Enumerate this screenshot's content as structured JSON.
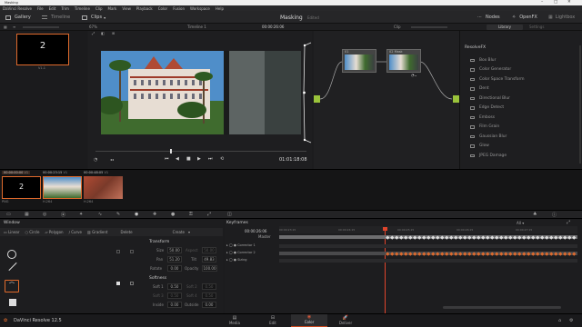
{
  "app": {
    "title": "Masking",
    "window_controls": [
      "–",
      "□",
      "✕"
    ]
  },
  "menu": [
    "DaVinci Resolve",
    "File",
    "Edit",
    "Trim",
    "Timeline",
    "Clip",
    "Mark",
    "View",
    "Playback",
    "Color",
    "Fusion",
    "Workspace",
    "Help"
  ],
  "toolbar": {
    "gallery": "Gallery",
    "timeline": "Timeline",
    "clips": "Clips",
    "project_name": "Masking",
    "project_status": "Edited",
    "nodes": "Nodes",
    "openfx": "OpenFX",
    "lightbox": "Lightbox"
  },
  "subbar": {
    "zoom": "67%",
    "timeline_name": "Timeline 1",
    "timecode": "00:00:26:06",
    "mode": "Clip",
    "library_tab": "Library",
    "settings_tab": "Settings"
  },
  "gallery": {
    "still_number": "2",
    "still_label": "V1.1"
  },
  "viewer": {
    "timecode": "01:01:18:08"
  },
  "nodes": {
    "node1_label": "01",
    "node2_label": "02 Mask",
    "node_tag_1": "",
    "node_tag_2": ""
  },
  "openfx": {
    "header": "ResolveFX",
    "items": [
      "Box Blur",
      "Color Generator",
      "Color Space Transform",
      "Dent",
      "Directional Blur",
      "Edge Detect",
      "Emboss",
      "Film Grain",
      "Gaussian Blur",
      "Glow",
      "JPEG Damage"
    ]
  },
  "clips": [
    {
      "tc": "00:00:00:00",
      "track": "V1",
      "codec": "PNG",
      "thumb_text": "2"
    },
    {
      "tc": "00:00:23:15",
      "track": "V1",
      "codec": "H.264",
      "thumb_text": ""
    },
    {
      "tc": "00:00:48:05",
      "track": "V1",
      "codec": "H.264",
      "thumb_text": ""
    }
  ],
  "window_panel": {
    "title": "Window",
    "shapes": [
      "Linear",
      "Circle",
      "Polygon",
      "Curve",
      "Gradient"
    ],
    "delete": "Delete",
    "create": "Create",
    "transform_title": "Transform",
    "size_label": "Size",
    "size_value": "50.00",
    "aspect_label": "Aspect",
    "aspect_value": "50.00",
    "pan_label": "Pan",
    "pan_value": "51.20",
    "tilt_label": "Tilt",
    "tilt_value": "49.83",
    "rotate_label": "Rotate",
    "rotate_value": "0.00",
    "opacity_label": "Opacity",
    "opacity_value": "100.00",
    "softness_title": "Softness",
    "soft1_label": "Soft 1",
    "soft1_value": "0.50",
    "soft2_label": "Soft 2",
    "soft2_value": "0.50",
    "soft3_label": "Soft 3",
    "soft3_value": "0.50",
    "soft4_label": "Soft 4",
    "soft4_value": "0.50",
    "inside_label": "Inside",
    "inside_value": "0.00",
    "outside_label": "Outside",
    "outside_value": "0.00"
  },
  "keyframes": {
    "title": "Keyframes",
    "filter": "All",
    "timecode": "00:00:26:06",
    "ruler": [
      "00:00:23:15",
      "00:00:24:15",
      "00:00:25:15",
      "00:00:26:15",
      "00:00:27:15",
      "00:00:28:15"
    ],
    "tracks": [
      "Master",
      "Corrector 1",
      "Corrector 2",
      "Sizing"
    ]
  },
  "bottom": {
    "app_name": "DaVinci Resolve 12.5",
    "pages": [
      "Media",
      "Edit",
      "Color",
      "Deliver"
    ],
    "active_page": "Color"
  },
  "colors": {
    "accent": "#e06a2c",
    "active": "#c8451b",
    "bg": "#1c1c1e"
  }
}
